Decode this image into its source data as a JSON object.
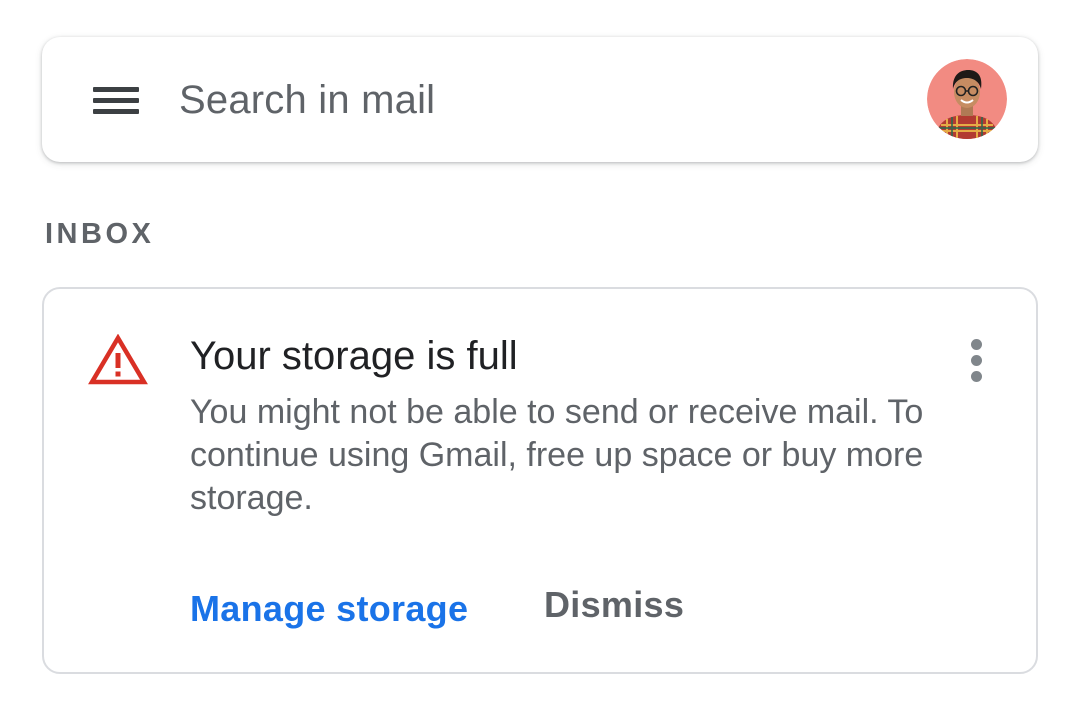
{
  "search": {
    "placeholder": "Search in mail",
    "menu_icon": "hamburger-menu-icon",
    "avatar_icon": "account-avatar"
  },
  "section": {
    "label": "INBOX"
  },
  "storage_card": {
    "icon": "warning-triangle-icon",
    "title": "Your storage is full",
    "body": "You might not be able to send or receive mail. To continue using Gmail, free up space or buy more storage.",
    "more_icon": "more-vertical-icon",
    "primary_action": "Manage storage",
    "secondary_action": "Dismiss"
  },
  "colors": {
    "accent": "#1a73e8",
    "warning": "#d93025",
    "text_primary": "#202124",
    "text_secondary": "#5f6368",
    "avatar_bg": "#f28b82"
  }
}
